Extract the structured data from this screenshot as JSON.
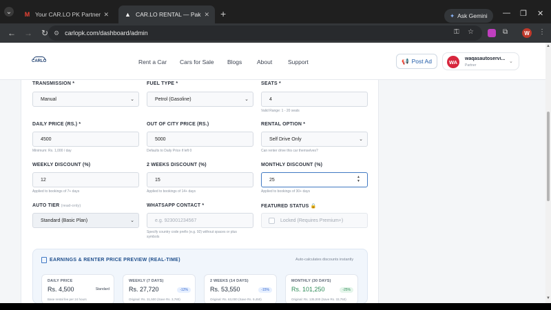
{
  "browser": {
    "tabs": [
      {
        "title": "Your CAR.LO PK Partner Applic...",
        "active": false,
        "favicon": "gmail-icon"
      },
      {
        "title": "CAR.LO RENTAL — Pakistan's #...",
        "active": true,
        "favicon": "carlo-icon"
      }
    ],
    "new_tab": "+",
    "ask_gemini": "Ask Gemini",
    "url": "carlopk.com/dashboard/admin",
    "profile_initial": "W"
  },
  "site": {
    "logo_text": "CARLO",
    "nav": [
      "Rent a Car",
      "Cars for Sale",
      "Blogs",
      "About",
      "Support"
    ],
    "post_ad": "Post Ad",
    "user": {
      "initials": "WA",
      "name": "waqasautoservi...",
      "role": "Partner"
    }
  },
  "form": {
    "transmission": {
      "label": "TRANSMISSION *",
      "value": "Manual"
    },
    "fuel_type": {
      "label": "FUEL TYPE *",
      "value": "Petrol (Gasoline)"
    },
    "seats": {
      "label": "SEATS *",
      "value": "4",
      "hint": "Valid Range: 1 - 20 seats"
    },
    "daily_price": {
      "label": "DAILY PRICE (RS.) *",
      "value": "4500",
      "hint": "Minimum: Rs. 1,000 / day"
    },
    "out_of_city_price": {
      "label": "OUT OF CITY PRICE (RS.)",
      "value": "5000",
      "hint": "Defaults to Daily Price if left 0"
    },
    "rental_option": {
      "label": "RENTAL OPTION *",
      "value": "Self Drive Only",
      "hint": "Can renter drive this car themselves?"
    },
    "weekly_discount": {
      "label": "WEEKLY DISCOUNT (%)",
      "value": "12",
      "hint": "Applied to bookings of 7+ days"
    },
    "two_weeks_discount": {
      "label": "2 WEEKS DISCOUNT (%)",
      "value": "15",
      "hint": "Applied to bookings of 14+ days"
    },
    "monthly_discount": {
      "label": "MONTHLY DISCOUNT (%)",
      "value": "25",
      "hint": "Applied to bookings of 30+ days"
    },
    "auto_tier": {
      "label": "AUTO TIER",
      "note": "(read-only)",
      "value": "Standard (Basic Plan)"
    },
    "whatsapp": {
      "label": "WHATSAPP CONTACT *",
      "placeholder": "e.g. 923001234567",
      "hint1": "Specify country code prefix (e.g. 92) without spaces or plus",
      "hint2": "symbols"
    },
    "featured": {
      "label": "FEATURED STATUS",
      "checkbox_label": "Locked (Requires Premium+)"
    }
  },
  "preview": {
    "title": "EARNINGS & RENTER PRICE PREVIEW (REAL-TIME)",
    "note": "Auto-calculates discounts instantly",
    "cards": [
      {
        "label": "DAILY PRICE",
        "price": "Rs. 4,500",
        "badge": "Standard",
        "sub": "Base rental fee per 24 hours"
      },
      {
        "label": "WEEKLY (7 DAYS)",
        "price": "Rs. 27,720",
        "badge": "-12%",
        "sub": "Original: Rs. 31,500 (Save Rs. 3,780)"
      },
      {
        "label": "2 WEEKS (14 DAYS)",
        "price": "Rs. 53,550",
        "badge": "-15%",
        "sub": "Original: Rs. 63,000 (Save Rs. 9,450)"
      },
      {
        "label": "MONTHLY (30 DAYS)",
        "price": "Rs. 101,250",
        "badge": "-25%",
        "sub": "Original: Rs. 135,000 (Save Rs. 33,750)"
      }
    ]
  }
}
